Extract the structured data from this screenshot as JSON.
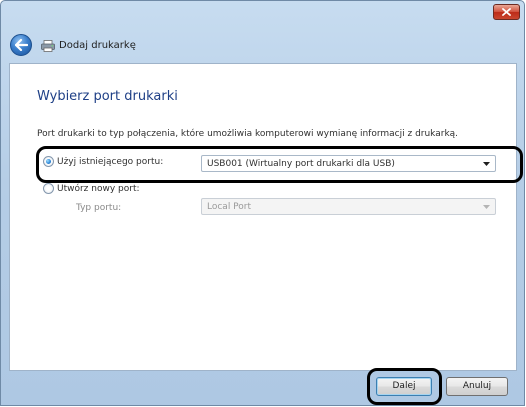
{
  "window": {
    "title": "Dodaj drukarkę",
    "colors": {
      "title_gradient": "#b5cde6",
      "close_button": "#c9462f",
      "heading": "#1e3f86",
      "highlight_ring": "#000000"
    }
  },
  "page": {
    "heading": "Wybierz port drukarki",
    "description": "Port drukarki to typ połączenia, które umożliwia komputerowi wymianę informacji z drukarką."
  },
  "options": {
    "existing": {
      "label": "Użyj istniejącego portu:",
      "selected": true,
      "value": "USB001 (Wirtualny port drukarki dla USB)"
    },
    "new": {
      "label": "Utwórz nowy port:",
      "selected": false,
      "type_label": "Typ portu:",
      "type_value": "Local Port"
    }
  },
  "buttons": {
    "next": "Dalej",
    "cancel": "Anuluj"
  },
  "icons": [
    "back-arrow-icon",
    "printer-icon",
    "close-icon",
    "dropdown-arrow-icon"
  ]
}
